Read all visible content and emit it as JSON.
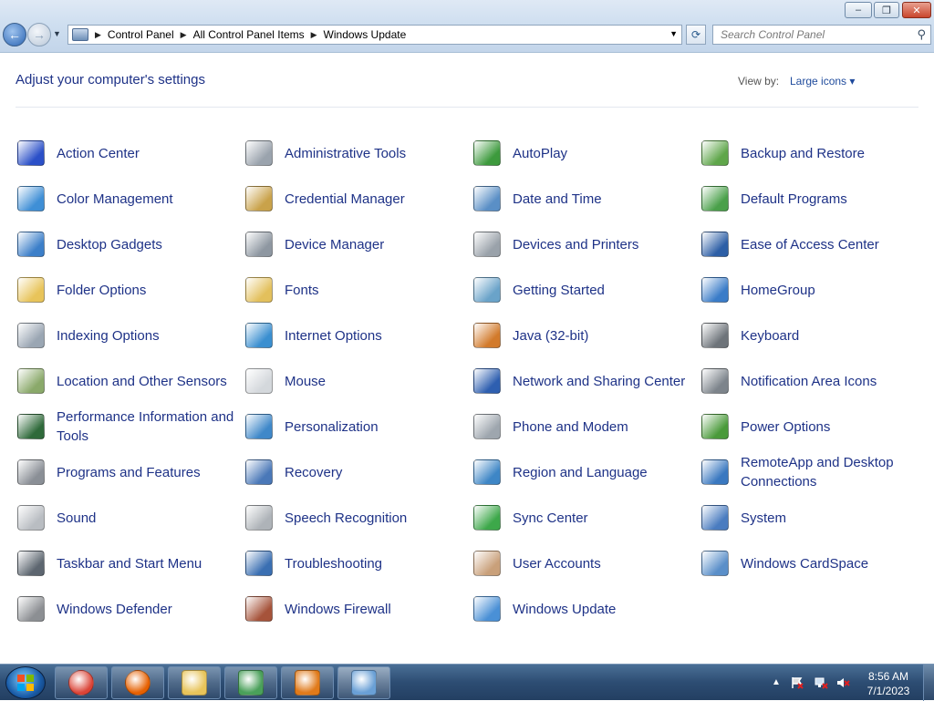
{
  "window": {
    "controls": {
      "minimize": "–",
      "maximize": "❐",
      "close": "✕"
    }
  },
  "navigation": {
    "back_glyph": "←",
    "forward_glyph": "→",
    "breadcrumbs": [
      "Control Panel",
      "All Control Panel Items",
      "Windows Update"
    ],
    "refresh_glyph": "⟳",
    "search_placeholder": "Search Control Panel"
  },
  "header": {
    "title": "Adjust your computer's settings",
    "view_by_label": "View by:",
    "view_by_value": "Large icons ▾"
  },
  "items": [
    [
      {
        "label": "Action Center",
        "icon": "flag-icon",
        "color": "#2b50c8"
      },
      {
        "label": "Color Management",
        "icon": "color-management-icon",
        "color": "#3f8fd6"
      },
      {
        "label": "Desktop Gadgets",
        "icon": "gadgets-icon",
        "color": "#3c7fc9"
      },
      {
        "label": "Folder Options",
        "icon": "folder-icon",
        "color": "#e8c45a"
      },
      {
        "label": "Indexing Options",
        "icon": "magnifier-icon",
        "color": "#9aa6b3"
      },
      {
        "label": "Location and Other Sensors",
        "icon": "sensors-icon",
        "color": "#8aa96a"
      },
      {
        "label": "Performance Information and Tools",
        "icon": "performance-icon",
        "color": "#2f6a3a"
      },
      {
        "label": "Programs and Features",
        "icon": "programs-icon",
        "color": "#8a8f96"
      },
      {
        "label": "Sound",
        "icon": "speaker-icon",
        "color": "#b9bdc2"
      },
      {
        "label": "Taskbar and Start Menu",
        "icon": "taskbar-icon",
        "color": "#5d6670"
      },
      {
        "label": "Windows Defender",
        "icon": "defender-icon",
        "color": "#8c8f93"
      }
    ],
    [
      {
        "label": "Administrative Tools",
        "icon": "admin-tools-icon",
        "color": "#9aa3ad"
      },
      {
        "label": "Credential Manager",
        "icon": "credential-icon",
        "color": "#c9a24a"
      },
      {
        "label": "Device Manager",
        "icon": "device-manager-icon",
        "color": "#8e97a1"
      },
      {
        "label": "Fonts",
        "icon": "fonts-icon",
        "color": "#e3c05c"
      },
      {
        "label": "Internet Options",
        "icon": "globe-icon",
        "color": "#3a8fd0"
      },
      {
        "label": "Mouse",
        "icon": "mouse-icon",
        "color": "#d4d8dc"
      },
      {
        "label": "Personalization",
        "icon": "personalization-icon",
        "color": "#3f88c9"
      },
      {
        "label": "Recovery",
        "icon": "recovery-icon",
        "color": "#4a78b8"
      },
      {
        "label": "Speech Recognition",
        "icon": "microphone-icon",
        "color": "#aeb3b8"
      },
      {
        "label": "Troubleshooting",
        "icon": "troubleshooting-icon",
        "color": "#3a6fb2"
      },
      {
        "label": "Windows Firewall",
        "icon": "firewall-icon",
        "color": "#a6533a"
      }
    ],
    [
      {
        "label": "AutoPlay",
        "icon": "autoplay-icon",
        "color": "#3d9a3d"
      },
      {
        "label": "Date and Time",
        "icon": "calendar-icon",
        "color": "#5a8fc6"
      },
      {
        "label": "Devices and Printers",
        "icon": "printer-icon",
        "color": "#9aa2aa"
      },
      {
        "label": "Getting Started",
        "icon": "getting-started-icon",
        "color": "#6aa3c9"
      },
      {
        "label": "Java (32-bit)",
        "icon": "java-icon",
        "color": "#d27a2b"
      },
      {
        "label": "Network and Sharing Center",
        "icon": "network-icon",
        "color": "#2e5fb0"
      },
      {
        "label": "Phone and Modem",
        "icon": "phone-icon",
        "color": "#9ea6ae"
      },
      {
        "label": "Region and Language",
        "icon": "region-icon",
        "color": "#3e86c6"
      },
      {
        "label": "Sync Center",
        "icon": "sync-icon",
        "color": "#3da84a"
      },
      {
        "label": "User Accounts",
        "icon": "users-icon",
        "color": "#c9a07a"
      },
      {
        "label": "Windows Update",
        "icon": "windows-update-icon",
        "color": "#4a90d6"
      }
    ],
    [
      {
        "label": "Backup and Restore",
        "icon": "backup-icon",
        "color": "#5fa64a"
      },
      {
        "label": "Default Programs",
        "icon": "default-programs-icon",
        "color": "#4aa04a"
      },
      {
        "label": "Ease of Access Center",
        "icon": "ease-of-access-icon",
        "color": "#2d5fa6"
      },
      {
        "label": "HomeGroup",
        "icon": "homegroup-icon",
        "color": "#3a7cc8"
      },
      {
        "label": "Keyboard",
        "icon": "keyboard-icon",
        "color": "#6e747a"
      },
      {
        "label": "Notification Area Icons",
        "icon": "notification-icon",
        "color": "#7d848b"
      },
      {
        "label": "Power Options",
        "icon": "power-icon",
        "color": "#4a9a3a"
      },
      {
        "label": "RemoteApp and Desktop Connections",
        "icon": "remoteapp-icon",
        "color": "#3a78c0"
      },
      {
        "label": "System",
        "icon": "system-icon",
        "color": "#4a7cc0"
      },
      {
        "label": "Windows CardSpace",
        "icon": "cardspace-icon",
        "color": "#5a8fc9"
      }
    ]
  ],
  "taskbar": {
    "pinned": [
      {
        "name": "chrome-icon",
        "color": "#db4437"
      },
      {
        "name": "firefox-icon",
        "color": "#e66000"
      },
      {
        "name": "file-explorer-icon",
        "color": "#e8c45a"
      },
      {
        "name": "network-app-icon",
        "color": "#4aa05a"
      },
      {
        "name": "magnifier-app-icon",
        "color": "#e07a1a"
      },
      {
        "name": "control-panel-icon",
        "color": "#6aa0d6"
      }
    ],
    "tray_arrow": "▲",
    "time": "8:56 AM",
    "date": "7/1/2023"
  }
}
